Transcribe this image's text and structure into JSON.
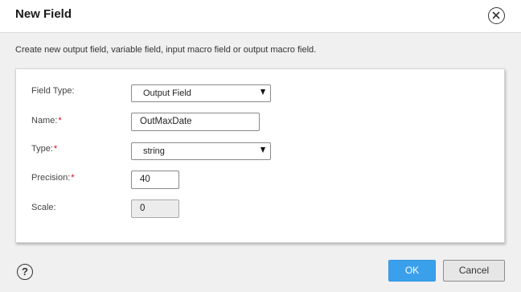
{
  "dialog": {
    "title": "New Field",
    "description": "Create new output field, variable field, input macro field or output macro field.",
    "close_icon": "close-circle-icon",
    "help_icon": "help-circle-icon",
    "help_glyph": "?"
  },
  "form": {
    "field_type": {
      "label": "Field Type:",
      "value": "Output Field",
      "required": false
    },
    "name": {
      "label": "Name:",
      "value": "OutMaxDate",
      "required": true
    },
    "type": {
      "label": "Type:",
      "value": "string",
      "required": true
    },
    "precision": {
      "label": "Precision:",
      "value": "40",
      "required": true
    },
    "scale": {
      "label": "Scale:",
      "value": "0",
      "required": false,
      "disabled": true
    },
    "required_marker": "*"
  },
  "buttons": {
    "ok_label": "OK",
    "cancel_label": "Cancel"
  },
  "colors": {
    "accent": "#3aa0ec",
    "required": "#d0021b",
    "dialog_background": "#f0f0f0"
  }
}
